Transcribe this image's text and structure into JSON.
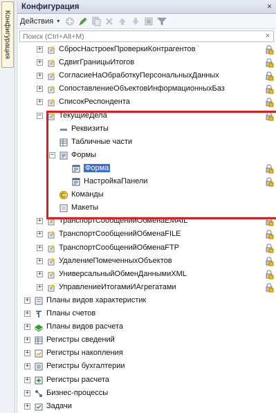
{
  "side_tab": {
    "label": "Конфигурация"
  },
  "window": {
    "title": "Конфигурация",
    "close_glyph": "×"
  },
  "toolbar": {
    "actions_label": "Действия",
    "actions_caret": "▾"
  },
  "search": {
    "placeholder": "Поиск (Ctrl+Alt+M)",
    "clear_glyph": "×"
  },
  "tree": {
    "rows": [
      {
        "label": "СбросНастроекПроверкиКонтрагентов",
        "icon": "document-object-icon",
        "expand": "+",
        "lock": true
      },
      {
        "label": "СдвигГраницыИтогов",
        "icon": "document-object-icon",
        "expand": "+",
        "lock": true
      },
      {
        "label": "СогласиеНаОбработкуПерсональныхДанных",
        "icon": "document-object-icon",
        "expand": "+",
        "lock": true
      },
      {
        "label": "СопоставлениеОбъектовИнформационныхБаз",
        "icon": "document-object-icon",
        "expand": "+",
        "lock": true
      },
      {
        "label": "СписокРеспондента",
        "icon": "document-object-icon",
        "expand": "+",
        "lock": true
      },
      {
        "label": "ТекущиеДела",
        "icon": "document-object-icon",
        "expand": "−",
        "lock": true
      },
      {
        "label": "Реквизиты",
        "icon": "attributes-icon",
        "expand": "",
        "lock": false
      },
      {
        "label": "Табличные части",
        "icon": "table-icon",
        "expand": "",
        "lock": false
      },
      {
        "label": "Формы",
        "icon": "form-folder-icon",
        "expand": "−",
        "lock": false
      },
      {
        "label": "Форма",
        "icon": "form-icon",
        "expand": "",
        "lock": true,
        "selected": true
      },
      {
        "label": "НастройкаПанели",
        "icon": "form-icon",
        "expand": "",
        "lock": true
      },
      {
        "label": "Команды",
        "icon": "command-icon",
        "expand": "",
        "lock": false
      },
      {
        "label": "Макеты",
        "icon": "template-icon",
        "expand": "",
        "lock": false
      },
      {
        "label": "ТранспортСообщенийОбменаEMAIL",
        "icon": "document-object-icon",
        "expand": "+",
        "lock": true
      },
      {
        "label": "ТранспортСообщенийОбменаFILE",
        "icon": "document-object-icon",
        "expand": "+",
        "lock": true
      },
      {
        "label": "ТранспортСообщенийОбменаFTP",
        "icon": "document-object-icon",
        "expand": "+",
        "lock": true
      },
      {
        "label": "УдалениеПомеченныхОбъектов",
        "icon": "document-object-icon",
        "expand": "+",
        "lock": true
      },
      {
        "label": "УниверсальныйОбменДаннымиXML",
        "icon": "document-object-icon",
        "expand": "+",
        "lock": true
      },
      {
        "label": "УправлениеИтогамиИАгрегатами",
        "icon": "document-object-icon",
        "expand": "+",
        "lock": true
      },
      {
        "label": "Планы видов характеристик",
        "icon": "chart-of-characteristics-icon",
        "expand": "+",
        "lock": false
      },
      {
        "label": "Планы счетов",
        "icon": "chart-of-accounts-icon",
        "expand": "+",
        "lock": false
      },
      {
        "label": "Планы видов расчета",
        "icon": "calculation-types-icon",
        "expand": "+",
        "lock": false
      },
      {
        "label": "Регистры сведений",
        "icon": "information-register-icon",
        "expand": "+",
        "lock": false
      },
      {
        "label": "Регистры накопления",
        "icon": "accumulation-register-icon",
        "expand": "+",
        "lock": false
      },
      {
        "label": "Регистры бухгалтерии",
        "icon": "accounting-register-icon",
        "expand": "+",
        "lock": false
      },
      {
        "label": "Регистры расчета",
        "icon": "calculation-register-icon",
        "expand": "+",
        "lock": false
      },
      {
        "label": "Бизнес-процессы",
        "icon": "business-process-icon",
        "expand": "+",
        "lock": false
      },
      {
        "label": "Задачи",
        "icon": "task-icon",
        "expand": "+",
        "lock": false
      }
    ]
  },
  "colors": {
    "highlight_box": "#e01b22",
    "selection": "#3a6fd1"
  }
}
